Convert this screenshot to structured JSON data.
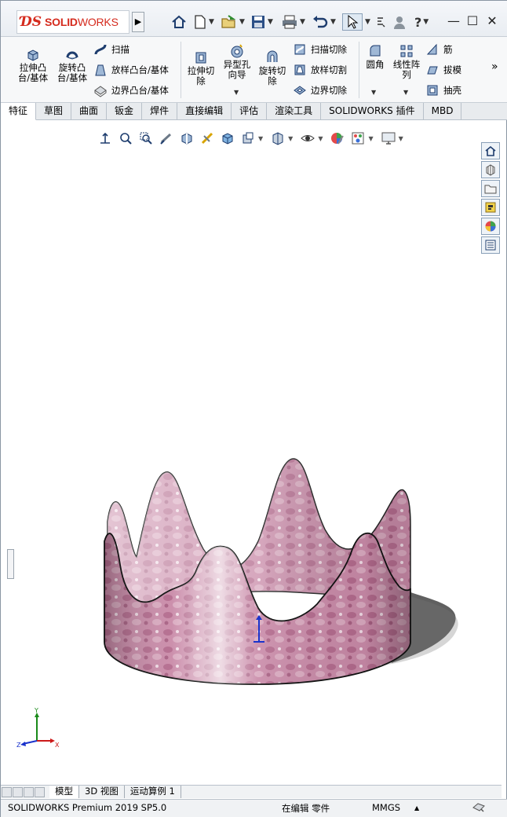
{
  "app": {
    "brand_left": "SOLID",
    "brand_right": "WORKS",
    "window_buttons": [
      "—",
      "☐",
      "✕"
    ]
  },
  "quick_access": {
    "help_label": "?"
  },
  "ribbon": {
    "extruded_boss": [
      "拉伸凸",
      "台/基体"
    ],
    "revolved_boss": [
      "旋转凸",
      "台/基体"
    ],
    "sweep": "扫描",
    "loft": "放样凸台/基体",
    "boundary": "边界凸台/基体",
    "extruded_cut": [
      "拉伸切",
      "除"
    ],
    "hole_wizard": [
      "异型孔",
      "向导"
    ],
    "revolved_cut": [
      "旋转切",
      "除"
    ],
    "swept_cut": "扫描切除",
    "lofted_cut": "放样切割",
    "boundary_cut": "边界切除",
    "fillet": "圆角",
    "linear_pattern": [
      "线性阵",
      "列"
    ],
    "rib": "筋",
    "draft": "拔模",
    "shell": "抽壳",
    "more": "»"
  },
  "tabs": [
    {
      "label": "特征",
      "active": true
    },
    {
      "label": "草图",
      "active": false
    },
    {
      "label": "曲面",
      "active": false
    },
    {
      "label": "钣金",
      "active": false
    },
    {
      "label": "焊件",
      "active": false
    },
    {
      "label": "直接编辑",
      "active": false
    },
    {
      "label": "评估",
      "active": false
    },
    {
      "label": "渲染工具",
      "active": false
    },
    {
      "label": "SOLIDWORKS 插件",
      "active": false
    },
    {
      "label": "MBD",
      "active": false
    }
  ],
  "triad": {
    "x": "X",
    "y": "Y",
    "z": "Z"
  },
  "bottom_tabs": [
    {
      "label": "模型",
      "active": true
    },
    {
      "label": "3D 视图",
      "active": false
    },
    {
      "label": "运动算例 1",
      "active": false
    }
  ],
  "status": {
    "product": "SOLIDWORKS Premium 2019 SP5.0",
    "mode": "在编辑 零件",
    "units": "MMGS",
    "units_caret": "▲"
  },
  "colors": {
    "brand_red": "#d52b1e",
    "model_pink": "#c97fa3",
    "icon_blue": "#1e3d6e"
  }
}
